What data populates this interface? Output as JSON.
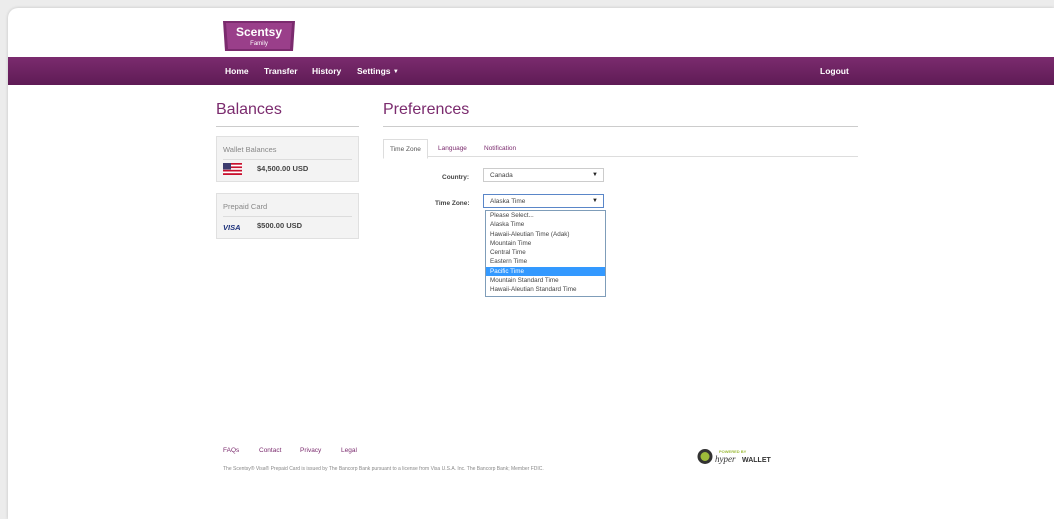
{
  "logo": {
    "line1": "Scentsy",
    "line2": "Family"
  },
  "nav": {
    "home": "Home",
    "transfer": "Transfer",
    "history": "History",
    "settings": "Settings",
    "logout": "Logout"
  },
  "balances": {
    "title": "Balances",
    "wallet": {
      "title": "Wallet Balances",
      "amount": "$4,500.00 USD",
      "icon": "us-flag-icon"
    },
    "prepaid": {
      "title": "Prepaid Card",
      "amount": "$500.00 USD",
      "card_brand": "VISA"
    }
  },
  "preferences": {
    "title": "Preferences",
    "tabs": [
      "Time Zone",
      "Language",
      "Notification"
    ],
    "active_tab": "Time Zone",
    "country": {
      "label": "Country:",
      "value": "Canada"
    },
    "timezone": {
      "label": "Time Zone:",
      "value": "Alaska Time",
      "options": [
        "Please Select...",
        "Alaska Time",
        "Hawaii-Aleutian Time (Adak)",
        "Mountain Time",
        "Central Time",
        "Eastern Time",
        "Pacific Time",
        "Mountain Standard Time",
        "Hawaii-Aleutian Standard Time"
      ],
      "highlighted": "Pacific Time"
    }
  },
  "footer": {
    "links": [
      "FAQs",
      "Contact",
      "Privacy",
      "Legal"
    ],
    "disclaimer": "The Scentsy® Visa® Prepaid Card is issued by The Bancorp Bank pursuant to a license from Visa U.S.A. Inc. The Bancorp Bank; Member FDIC.",
    "badge": {
      "top": "POWERED BY",
      "brand1": "hyper",
      "brand2": "WALLET"
    }
  },
  "colors": {
    "brand": "#7b2b6e",
    "highlight": "#3399ff"
  }
}
